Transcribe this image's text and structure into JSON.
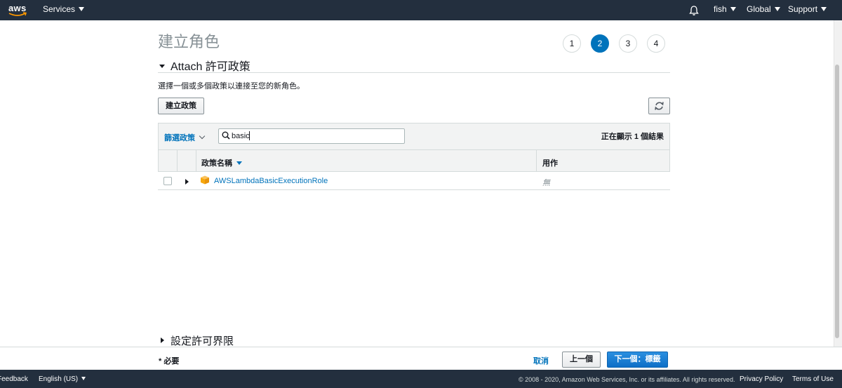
{
  "topnav": {
    "logo_text": "aws",
    "services_label": "Services",
    "user_label": "fish",
    "region_label": "Global",
    "support_label": "Support"
  },
  "page": {
    "title": "建立角色",
    "steps": [
      "1",
      "2",
      "3",
      "4"
    ],
    "active_step": "2"
  },
  "section": {
    "heading": "Attach 許可政策",
    "description": "選擇一個或多個政策以連接至您的新角色。",
    "create_policy_label": "建立政策"
  },
  "table": {
    "filter_label": "篩選政策",
    "search_value": "basic",
    "showing_text": "正在顯示 1 個結果",
    "columns": {
      "name": "政策名稱",
      "usage": "用作"
    },
    "rows": [
      {
        "name": "AWSLambdaBasicExecutionRole",
        "usage": "無"
      }
    ]
  },
  "collapsed_section": {
    "heading": "設定許可界限"
  },
  "actions": {
    "required_text": "* 必要",
    "cancel_label": "取消",
    "previous_label": "上一個",
    "next_label": "下一個：標籤"
  },
  "footer": {
    "feedback_label": "Feedback",
    "language_label": "English (US)",
    "copyright": "© 2008 - 2020, Amazon Web Services, Inc. or its affiliates. All rights reserved.",
    "privacy_label": "Privacy Policy",
    "terms_label": "Terms of Use"
  },
  "colors": {
    "nav_bg": "#232f3e",
    "link_blue": "#0073bb",
    "primary_blue": "#0d6fc7",
    "policy_icon": "#f7a80d"
  }
}
